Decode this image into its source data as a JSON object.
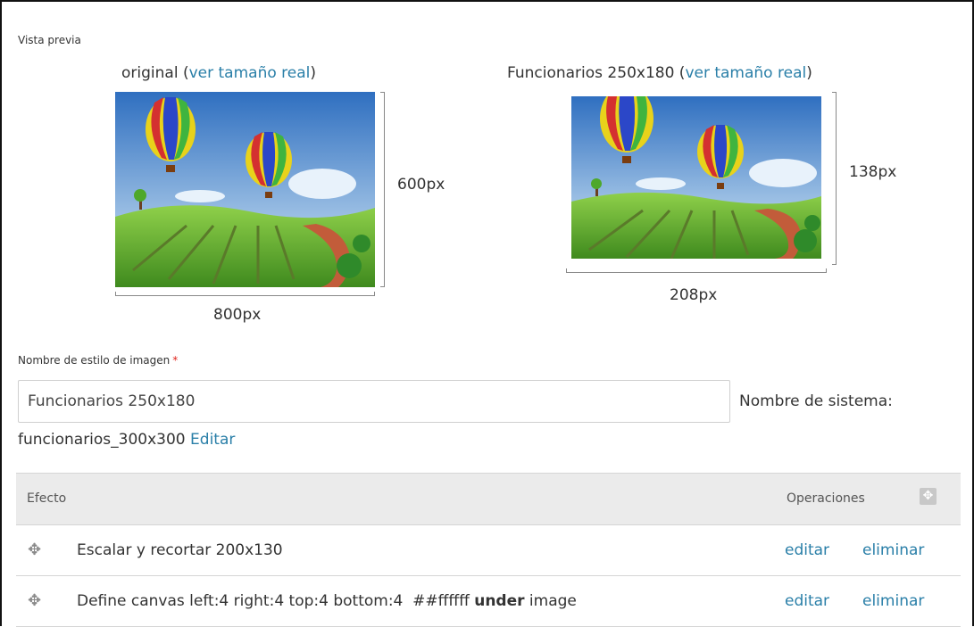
{
  "preview": {
    "section_label": "Vista previa",
    "original": {
      "caption_name": "original",
      "caption_link": "ver tamaño real",
      "width_label": "800px",
      "height_label": "600px"
    },
    "derived": {
      "caption_name": "Funcionarios 250x180",
      "caption_link": "ver tamaño real",
      "width_label": "208px",
      "height_label": "138px"
    }
  },
  "form": {
    "name_label": "Nombre de estilo de imagen",
    "required_mark": "*",
    "name_value": "Funcionarios 250x180",
    "system_name_label": "Nombre de sistema:",
    "system_name_value": "funcionarios_300x300",
    "edit_link": "Editar"
  },
  "effects_table": {
    "col_effect": "Efecto",
    "col_operations": "Operaciones",
    "rows": [
      {
        "effect": "Escalar y recortar 200x130",
        "edit": "editar",
        "delete": "eliminar"
      },
      {
        "effect_prefix": "Define canvas left:4 right:4 top:4 bottom:4  ##ffffff ",
        "effect_bold": "under",
        "effect_suffix": " image",
        "edit": "editar",
        "delete": "eliminar"
      }
    ]
  },
  "colors": {
    "link": "#2a7fa8",
    "header_bg": "#ebebeb",
    "required": "#e0241c"
  }
}
